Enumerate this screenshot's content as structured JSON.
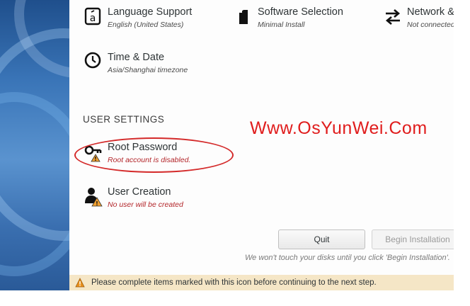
{
  "localization": {
    "language_support": {
      "title": "Language Support",
      "status": "English (United States)",
      "icon": "language-icon"
    },
    "time_date": {
      "title": "Time & Date",
      "status": "Asia/Shanghai timezone",
      "icon": "clock-icon"
    }
  },
  "software": {
    "software_selection": {
      "title": "Software Selection",
      "status": "Minimal Install",
      "icon": "package-icon"
    }
  },
  "system": {
    "network": {
      "title": "Network &",
      "status": "Not connected",
      "icon": "network-arrows-icon"
    }
  },
  "user_settings": {
    "heading": "USER SETTINGS",
    "root_password": {
      "title": "Root Password",
      "status": "Root account is disabled.",
      "icon": "key-warning-icon"
    },
    "user_creation": {
      "title": "User Creation",
      "status": "No user will be created",
      "icon": "user-warning-icon"
    }
  },
  "watermark": "Www.OsYunWei.Com",
  "actions": {
    "quit_label": "Quit",
    "begin_label": "Begin Installation",
    "footnote": "We won't touch your disks until you click 'Begin Installation'."
  },
  "warning_bar": {
    "icon": "warning-icon",
    "text": "Please complete items marked with this icon before continuing to the next step."
  },
  "colors": {
    "warning_text": "#b3262a",
    "annotation_red": "#d42a2a",
    "warning_bar_bg": "#f5e6c6",
    "sidebar_blue": "#3a75b8"
  }
}
